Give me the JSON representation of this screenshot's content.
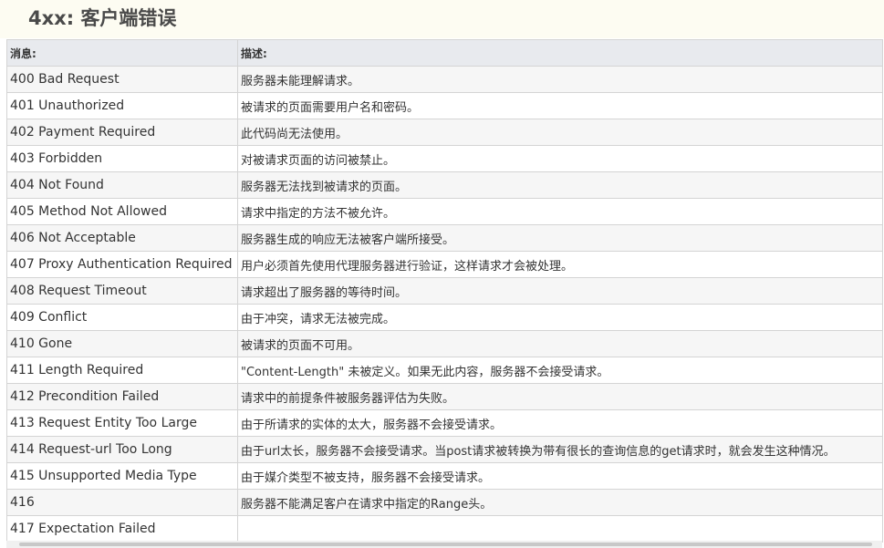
{
  "page_title": "4xx: 客户端错误",
  "table": {
    "headers": [
      "消息:",
      "描述:"
    ],
    "rows": [
      {
        "code": "400 Bad Request",
        "desc": "服务器未能理解请求。"
      },
      {
        "code": "401 Unauthorized",
        "desc": "被请求的页面需要用户名和密码。"
      },
      {
        "code": "402 Payment Required",
        "desc": "此代码尚无法使用。"
      },
      {
        "code": "403 Forbidden",
        "desc": "对被请求页面的访问被禁止。"
      },
      {
        "code": "404 Not Found",
        "desc": "服务器无法找到被请求的页面。"
      },
      {
        "code": "405 Method Not Allowed",
        "desc": "请求中指定的方法不被允许。"
      },
      {
        "code": "406 Not Acceptable",
        "desc": "服务器生成的响应无法被客户端所接受。"
      },
      {
        "code": "407 Proxy Authentication Required",
        "desc": "用户必须首先使用代理服务器进行验证，这样请求才会被处理。"
      },
      {
        "code": "408 Request Timeout",
        "desc": "请求超出了服务器的等待时间。"
      },
      {
        "code": "409 Conflict",
        "desc": "由于冲突，请求无法被完成。"
      },
      {
        "code": "410 Gone",
        "desc": "被请求的页面不可用。"
      },
      {
        "code": "411 Length Required",
        "desc": "\"Content-Length\" 未被定义。如果无此内容，服务器不会接受请求。"
      },
      {
        "code": "412 Precondition Failed",
        "desc": "请求中的前提条件被服务器评估为失败。"
      },
      {
        "code": "413 Request Entity Too Large",
        "desc": "由于所请求的实体的太大，服务器不会接受请求。"
      },
      {
        "code": "414 Request-url Too Long",
        "desc": "由于url太长，服务器不会接受请求。当post请求被转换为带有很长的查询信息的get请求时，就会发生这种情况。"
      },
      {
        "code": "415 Unsupported Media Type",
        "desc": "由于媒介类型不被支持，服务器不会接受请求。"
      },
      {
        "code": "416",
        "desc": "服务器不能满足客户在请求中指定的Range头。"
      },
      {
        "code": "417 Expectation Failed",
        "desc": ""
      }
    ]
  }
}
